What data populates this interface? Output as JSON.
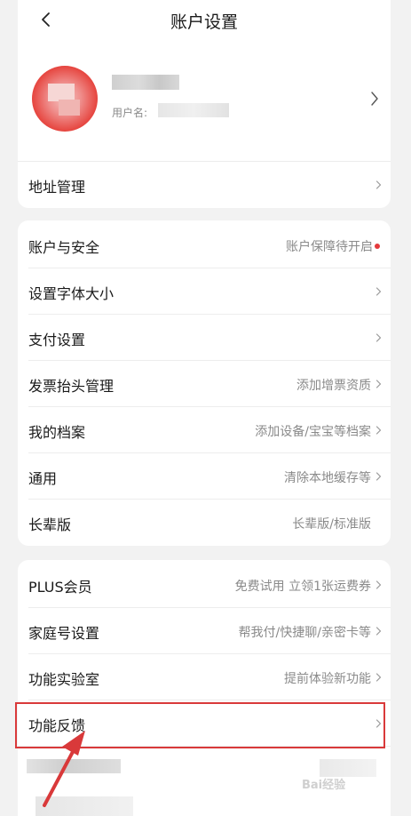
{
  "header": {
    "title": "账户设置"
  },
  "profile": {
    "username_label": "用户名:"
  },
  "address": {
    "label": "地址管理"
  },
  "group2": [
    {
      "label": "账户与安全",
      "value": "账户保障待开启",
      "dot": true
    },
    {
      "label": "设置字体大小",
      "value": ""
    },
    {
      "label": "支付设置",
      "value": ""
    },
    {
      "label": "发票抬头管理",
      "value": "添加增票资质"
    },
    {
      "label": "我的档案",
      "value": "添加设备/宝宝等档案"
    },
    {
      "label": "通用",
      "value": "清除本地缓存等"
    },
    {
      "label": "长辈版",
      "value": "长辈版/标准版"
    }
  ],
  "group3": [
    {
      "label": "PLUS会员",
      "value": "免费试用 立领1张运费券"
    },
    {
      "label": "家庭号设置",
      "value": "帮我付/快捷聊/亲密卡等"
    },
    {
      "label": "功能实验室",
      "value": "提前体验新功能"
    },
    {
      "label": "功能反馈",
      "value": ""
    }
  ],
  "watermark": {
    "text": "Bai经验"
  },
  "colors": {
    "highlight": "#d9393a",
    "red_dot": "#e4393c",
    "background": "#f2f2f2",
    "card": "#ffffff"
  },
  "icons": {
    "back": "chevron-left-icon",
    "row_arrow": "chevron-right-icon"
  }
}
